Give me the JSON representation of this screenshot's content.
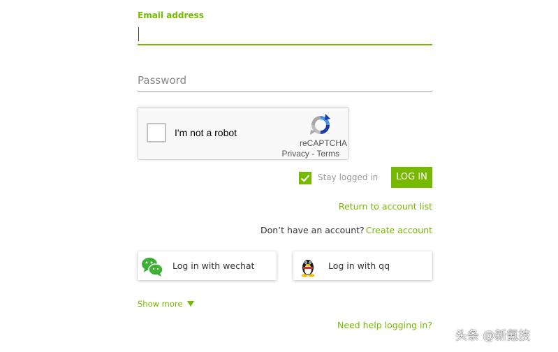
{
  "login_form": {
    "email": {
      "label": "Email address",
      "value": ""
    },
    "password": {
      "placeholder": "Password",
      "value": ""
    },
    "recaptcha": {
      "label": "I'm not a robot",
      "brand": "reCAPTCHA",
      "links": "Privacy - Terms",
      "icon": "recaptcha-logo"
    },
    "stay_logged_in": {
      "label": "Stay logged in",
      "checked": true
    },
    "login_button": "LOG IN",
    "return_link": "Return to account list",
    "no_account_text": "Don’t have an account?",
    "create_account_link": "Create account",
    "social": [
      {
        "label": "Log in with wechat",
        "icon": "wechat-icon"
      },
      {
        "label": "Log in with qq",
        "icon": "qq-icon"
      }
    ],
    "show_more": "Show more",
    "help_link": "Need help logging in?"
  },
  "watermark": "头条 @新氪技",
  "colors": {
    "accent": "#76b900",
    "muted": "#999999",
    "text": "#333333"
  }
}
